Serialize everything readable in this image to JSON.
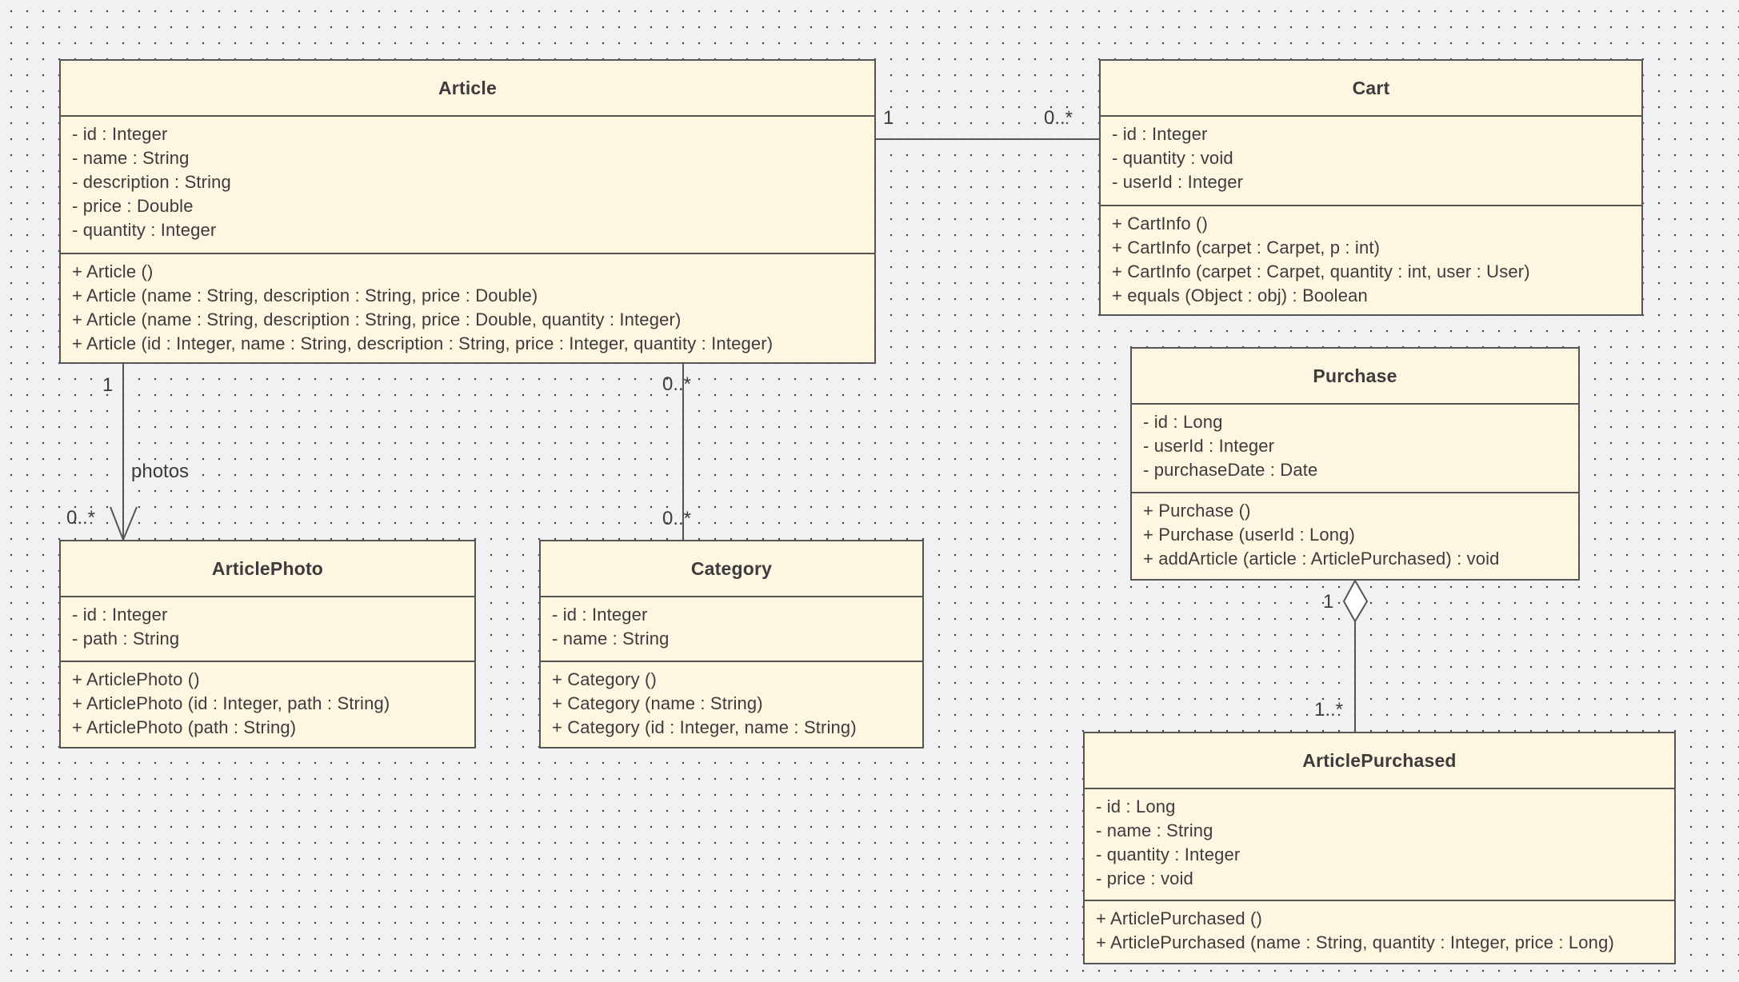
{
  "diagram": {
    "type": "UML class diagram",
    "colors": {
      "background": "#f1f1f4",
      "class_fill": "#fff6e2",
      "border": "#555555",
      "text": "#3c3c3c"
    },
    "classes": {
      "article": {
        "name": "Article",
        "attributes": [
          "- id : Integer",
          "- name : String",
          "- description : String",
          "- price : Double",
          "- quantity : Integer"
        ],
        "methods": [
          "+ Article ()",
          "+ Article (name : String, description : String, price : Double)",
          "+ Article (name : String, description : String, price : Double, quantity : Integer)",
          "+ Article (id : Integer, name : String, description : String, price : Integer, quantity : Integer)"
        ]
      },
      "cart": {
        "name": "Cart",
        "attributes": [
          "- id : Integer",
          "- quantity : void",
          "- userId : Integer"
        ],
        "methods": [
          "+ CartInfo ()",
          "+ CartInfo (carpet : Carpet, p : int)",
          "+ CartInfo (carpet : Carpet, quantity : int, user : User)",
          "+ equals (Object : obj) : Boolean"
        ]
      },
      "purchase": {
        "name": "Purchase",
        "attributes": [
          "- id : Long",
          "- userId : Integer",
          "- purchaseDate : Date"
        ],
        "methods": [
          "+ Purchase ()",
          "+ Purchase (userId : Long)",
          "+ addArticle (article : ArticlePurchased) : void"
        ]
      },
      "article_photo": {
        "name": "ArticlePhoto",
        "attributes": [
          "- id : Integer",
          "- path : String"
        ],
        "methods": [
          "+ ArticlePhoto ()",
          "+ ArticlePhoto (id : Integer, path : String)",
          "+ ArticlePhoto (path : String)"
        ]
      },
      "category": {
        "name": "Category",
        "attributes": [
          "- id : Integer",
          "- name : String"
        ],
        "methods": [
          "+ Category ()",
          "+ Category (name : String)",
          "+ Category (id : Integer, name : String)"
        ]
      },
      "article_purchased": {
        "name": "ArticlePurchased",
        "attributes": [
          "- id : Long",
          "- name : String",
          "- quantity : Integer",
          "- price : void"
        ],
        "methods": [
          "+ ArticlePurchased ()",
          "+ ArticlePurchased (name : String, quantity : Integer, price : Long)"
        ]
      }
    },
    "relationships": {
      "article_cart": {
        "kind": "association",
        "from": "Article",
        "to": "Cart",
        "from_mult": "1",
        "to_mult": "0..*"
      },
      "article_photos": {
        "kind": "directed-association",
        "from": "Article",
        "to": "ArticlePhoto",
        "label": "photos",
        "from_mult": "1",
        "to_mult": "0..*"
      },
      "article_category": {
        "kind": "association",
        "from": "Article",
        "to": "Category",
        "from_mult": "0..*",
        "to_mult": "0..*"
      },
      "purchase_articlepurchased": {
        "kind": "aggregation",
        "from": "Purchase",
        "to": "ArticlePurchased",
        "from_mult": "1",
        "to_mult": "1..*"
      }
    }
  }
}
